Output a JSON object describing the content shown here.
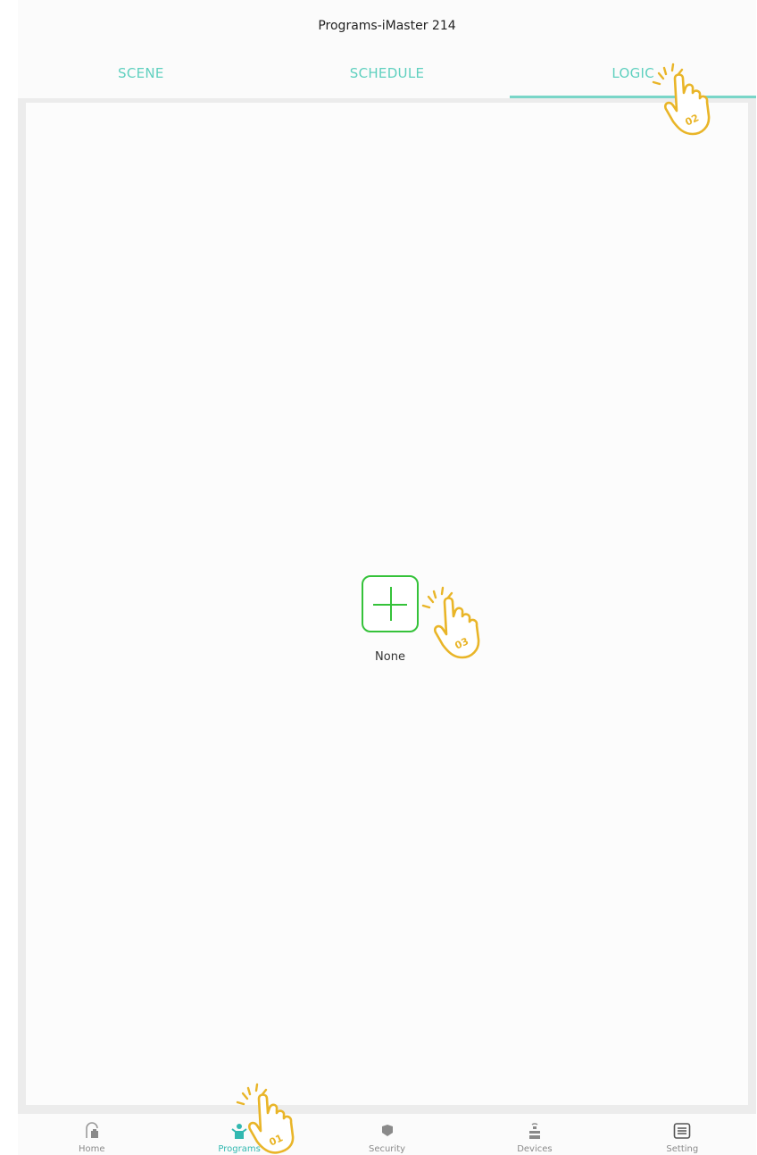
{
  "header": {
    "title": "Programs-iMaster 214"
  },
  "tabs": [
    {
      "label": "SCENE"
    },
    {
      "label": "SCHEDULE"
    },
    {
      "label": "LOGIC",
      "active": true
    }
  ],
  "content": {
    "add_label": "None"
  },
  "bottom_nav": [
    {
      "label": "Home"
    },
    {
      "label": "Programs",
      "active": true
    },
    {
      "label": "Security"
    },
    {
      "label": "Devices"
    },
    {
      "label": "Setting"
    }
  ],
  "annotations": [
    {
      "label": "01"
    },
    {
      "label": "02"
    },
    {
      "label": "03"
    }
  ],
  "colors": {
    "accent": "#5fd0bf",
    "tab_underline": "#79d6c8",
    "add_button": "#35c23a",
    "hand_marker": "#e9b528",
    "nav_active": "#32b8b0"
  }
}
